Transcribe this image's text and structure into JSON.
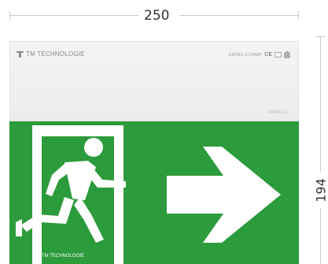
{
  "dimensions": {
    "width_label": "250",
    "height_label": "194"
  },
  "housing": {
    "brand_text": "TM TECHNOLOGIE",
    "cert_text": "DINTEC-S-CHART",
    "ce_mark": "CE",
    "small_label": "DINTEC-C",
    "led_left": "·",
    "led_right": "·"
  },
  "sign": {
    "brand_text": "TM TECHNOLOGIE",
    "background_color": "#2c9b3b",
    "arrow_icon": "right-arrow-icon",
    "figure_icon": "running-man-icon",
    "door_icon": "exit-door-icon"
  }
}
